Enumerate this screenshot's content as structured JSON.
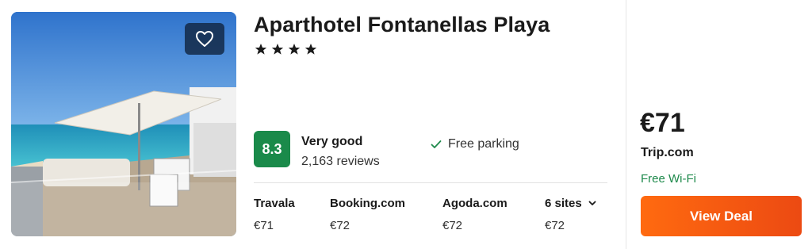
{
  "hotel": {
    "name": "Aparthotel Fontanellas Playa",
    "star_count": 4,
    "favorite_icon": "heart-outline-icon",
    "photo_alt": "hotel terrace with umbrella overlooking beach"
  },
  "rating": {
    "score": "8.3",
    "label": "Very good",
    "reviews": "2,163 reviews",
    "score_color": "#1a8a4a"
  },
  "amenities": [
    {
      "icon": "check-icon",
      "label": "Free parking"
    }
  ],
  "providers": [
    {
      "name": "Travala",
      "price": "€71"
    },
    {
      "name": "Booking.com",
      "price": "€72"
    },
    {
      "name": "Agoda.com",
      "price": "€72"
    },
    {
      "name": "6 sites",
      "price": "€72",
      "icon": "chevron-down-icon"
    }
  ],
  "deal": {
    "price": "€71",
    "site": "Trip.com",
    "perk": "Free Wi-Fi",
    "button_label": "View Deal",
    "button_color": "#f25c14",
    "perk_color": "#1f8a4c"
  }
}
